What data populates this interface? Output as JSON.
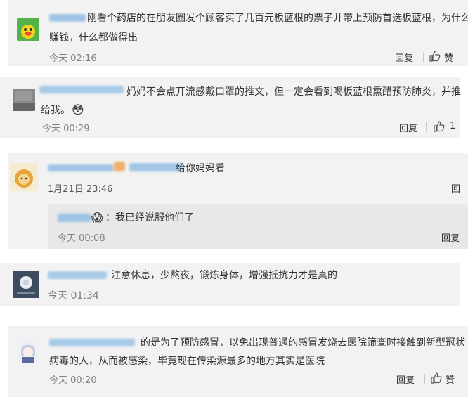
{
  "comments": [
    {
      "text_line1": "刚看个药店的在朋友圈发个顾客买了几百元板蓝根的票子并带上预防首选板蓝根，为什么",
      "text_line2": "赚钱，什么都做得出",
      "time": "今天 02:16",
      "reply": "回复",
      "like": "赞"
    },
    {
      "text_line1": "妈妈不会点开流感戴口罩的推文，但一定会看到喝板蓝根熏醋预防肺炎，并推",
      "text_line2": "给我。",
      "emoji": "😳",
      "time": "今天 00:29",
      "reply": "回复",
      "like_count": "1"
    },
    {
      "text": "给你妈妈看",
      "time": "1月21日 23:46",
      "reply_partial": "回",
      "sub_reply": {
        "emoji": "😱",
        "text": "：我已经说服他们了",
        "time": "今天 00:08",
        "reply": "回复"
      }
    },
    {
      "text": "注意休息，少熬夜，锻炼身体，增强抵抗力才是真的",
      "time": "今天 01:34"
    },
    {
      "text_line1": "的是为了预防感冒，以免出现普通的感冒发烧去医院筛查时接触到新型冠状",
      "text_line2": "病毒的人，从而被感染，毕竟现在传染源最多的地方其实是医院",
      "time": "今天 00:20",
      "reply": "回复",
      "like": "赞"
    }
  ]
}
